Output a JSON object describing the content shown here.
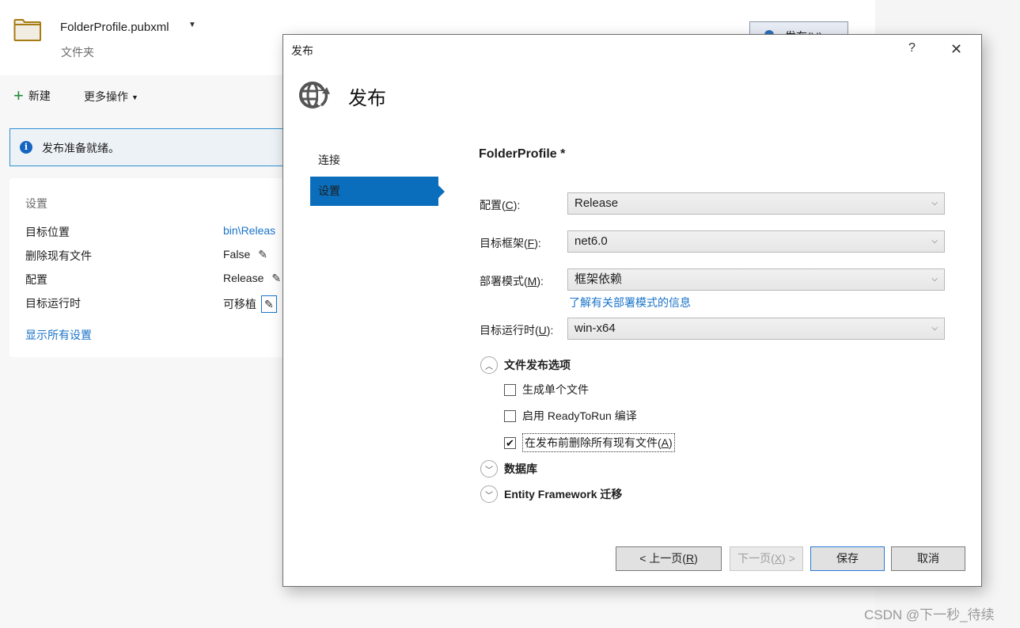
{
  "background": {
    "profile_name": "FolderProfile.pubxml",
    "profile_type": "文件夹",
    "publish_button_label": "发布(U)",
    "toolbar": {
      "new_label": "新建",
      "more_actions_label": "更多操作"
    },
    "info_bar": {
      "text": "发布准备就绪。"
    },
    "settings": {
      "title": "设置",
      "rows": [
        {
          "key": "目标位置",
          "value": "bin\\Releas"
        },
        {
          "key": "删除现有文件",
          "value": "False"
        },
        {
          "key": "配置",
          "value": "Release"
        },
        {
          "key": "目标运行时",
          "value": "可移植"
        }
      ],
      "show_all_label": "显示所有设置"
    }
  },
  "dialog": {
    "title": "发布",
    "help_label": "?",
    "close_label": "✕",
    "heading": "发布",
    "nav": [
      {
        "label": "连接",
        "selected": false
      },
      {
        "label": "设置",
        "selected": true
      }
    ],
    "profile_heading": "FolderProfile *",
    "fields": {
      "configuration": {
        "label_pre": "配置(",
        "accel": "C",
        "label_post": "):",
        "value": "Release"
      },
      "target_framework": {
        "label_pre": "目标框架(",
        "accel": "F",
        "label_post": "):",
        "value": "net6.0"
      },
      "deployment_mode": {
        "label_pre": "部署模式(",
        "accel": "M",
        "label_post": "):",
        "value": "框架依赖"
      },
      "target_runtime": {
        "label_pre": "目标运行时(",
        "accel": "U",
        "label_post": "):",
        "value": "win-x64"
      }
    },
    "deployment_link": "了解有关部署模式的信息",
    "sections": {
      "file_publish_options": {
        "label": "文件发布选项",
        "expanded": true
      },
      "database": {
        "label": "数据库",
        "expanded": false
      },
      "ef_migrations": {
        "label": "Entity Framework 迁移",
        "expanded": false
      }
    },
    "options": [
      {
        "label": "生成单个文件",
        "checked": false
      },
      {
        "label": "启用 ReadyToRun 编译",
        "checked": false
      },
      {
        "label_pre": "在发布前删除所有现有文件(",
        "accel": "A",
        "label_post": ")",
        "checked": true
      }
    ],
    "buttons": {
      "prev_pre": "< 上一页(",
      "prev_accel": "R",
      "prev_post": ")",
      "next_pre": "下一页(",
      "next_accel": "X",
      "next_post": ") >",
      "save": "保存",
      "cancel": "取消"
    }
  },
  "watermark": "CSDN @下一秒_待续",
  "colors": {
    "accent": "#0a6ebd",
    "link": "#1a73c8",
    "info_border": "#2f90d5"
  }
}
